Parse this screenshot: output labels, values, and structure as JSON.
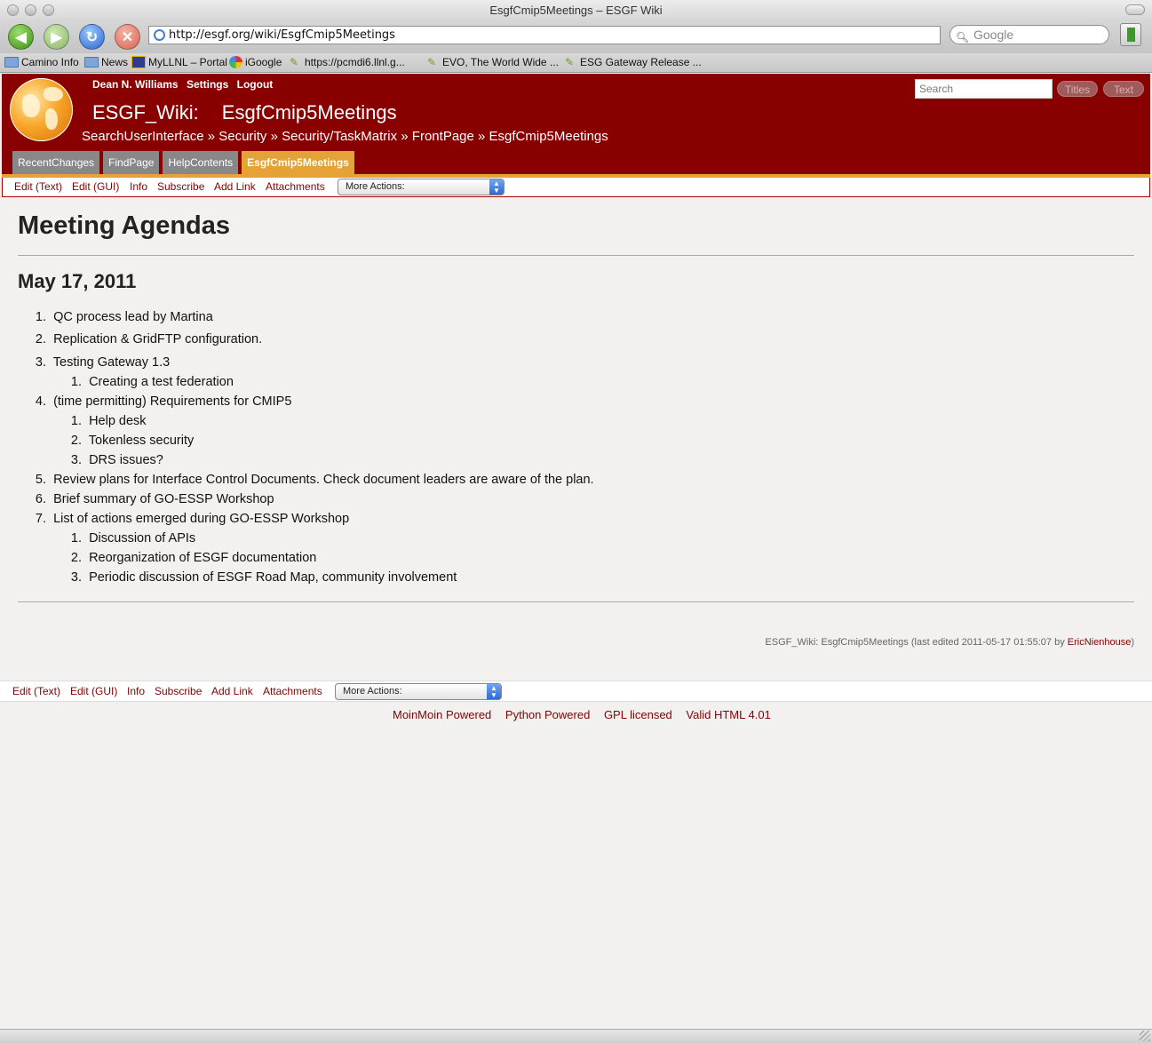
{
  "window": {
    "title": "EsgfCmip5Meetings – ESGF Wiki"
  },
  "toolbar": {
    "url": "http://esgf.org/wiki/EsgfCmip5Meetings",
    "search_placeholder": "Google"
  },
  "bookmarks": [
    {
      "label": "Camino Info",
      "icon": "folder-icon"
    },
    {
      "label": "News",
      "icon": "folder-icon"
    },
    {
      "label": "MyLLNL – Portal",
      "icon": "llnl-icon"
    },
    {
      "label": "iGoogle",
      "icon": "igoogle-icon"
    },
    {
      "label": "https://pcmdi6.llnl.g...",
      "icon": "leaf-icon"
    },
    {
      "label": "EVO, The World Wide ...",
      "icon": "leaf-icon"
    },
    {
      "label": "ESG Gateway Release ...",
      "icon": "leaf-icon"
    }
  ],
  "header": {
    "user": "Dean N. Williams",
    "settings": "Settings",
    "logout": "Logout",
    "site": "ESGF_Wiki:",
    "page": "EsgfCmip5Meetings",
    "trail": "SearchUserInterface » Security » Security/TaskMatrix » FrontPage » EsgfCmip5Meetings",
    "search_placeholder": "Search",
    "titles_btn": "Titles",
    "text_btn": "Text",
    "tabs": [
      "RecentChanges",
      "FindPage",
      "HelpContents",
      "EsgfCmip5Meetings"
    ]
  },
  "editbar": {
    "items": [
      "Edit (Text)",
      "Edit (GUI)",
      "Info",
      "Subscribe",
      "Add Link",
      "Attachments"
    ],
    "more_actions": "More Actions:"
  },
  "content": {
    "title": "Meeting Agendas",
    "date": "May 17, 2011",
    "items": [
      "QC process lead by Martina",
      "Replication & GridFTP configuration.",
      "Testing Gateway 1.3",
      "Creating a test federation",
      "(time permitting) Requirements for CMIP5",
      "Help desk",
      "Tokenless security",
      "DRS issues?",
      "Review plans for Interface Control Documents. Check document leaders are aware of the plan.",
      "Brief summary of GO-ESSP Workshop",
      "List of actions emerged during GO-ESSP Workshop",
      "Discussion of APIs",
      "Reorganization of ESGF documentation",
      "Periodic discussion of ESGF Road Map, community involvement"
    ],
    "numbers": [
      "1.",
      "2.",
      "3.",
      "1.",
      "4.",
      "1.",
      "2.",
      "3.",
      "5.",
      "6.",
      "7.",
      "1.",
      "2.",
      "3."
    ]
  },
  "footer": {
    "info": "ESGF_Wiki: EsgfCmip5Meetings (last edited 2011-05-17 01:55:07 by ",
    "editor": "EricNienhouse",
    "close": ")",
    "badges": [
      "MoinMoin Powered",
      "Python Powered",
      "GPL licensed",
      "Valid HTML 4.01"
    ]
  },
  "colors": {
    "header_bg": "#880000",
    "tab_active": "#e5a236",
    "link": "#880000"
  }
}
